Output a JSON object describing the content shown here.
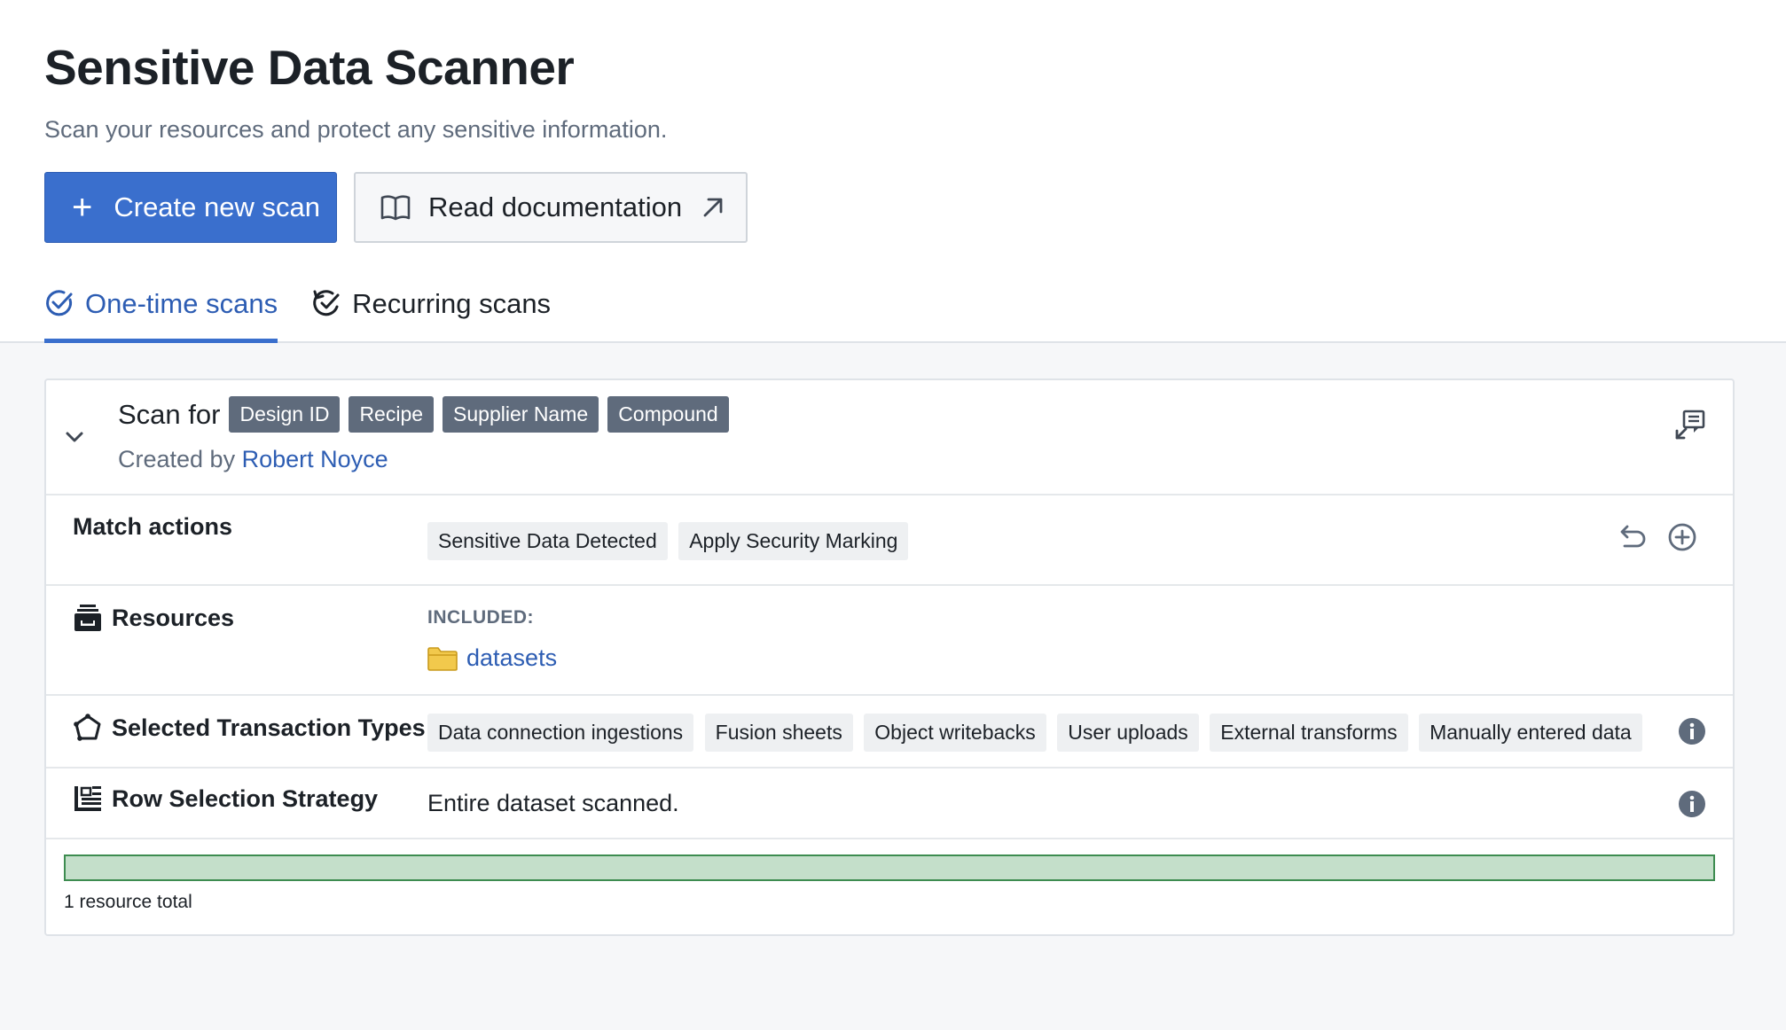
{
  "header": {
    "title": "Sensitive Data Scanner",
    "subtitle": "Scan your resources and protect any sensitive information.",
    "create_button": "Create new scan",
    "docs_button": "Read documentation"
  },
  "tabs": [
    {
      "label": "One-time scans",
      "active": true,
      "icon": "circle-check-icon"
    },
    {
      "label": "Recurring scans",
      "active": false,
      "icon": "recurring-check-icon"
    }
  ],
  "scan": {
    "scan_for_label": "Scan for",
    "categories": [
      "Design ID",
      "Recipe",
      "Supplier Name",
      "Compound"
    ],
    "created_by_label": "Created by",
    "created_by_name": "Robert Noyce",
    "rows": {
      "match_actions": {
        "label": "Match actions",
        "chips": [
          "Sensitive Data Detected",
          "Apply Security Marking"
        ]
      },
      "resources": {
        "label": "Resources",
        "included_label": "INCLUDED:",
        "folder": "datasets"
      },
      "transaction_types": {
        "label": "Selected Transaction Types",
        "chips": [
          "Data connection ingestions",
          "Fusion sheets",
          "Object writebacks",
          "User uploads",
          "External transforms",
          "Manually entered data"
        ]
      },
      "row_selection": {
        "label": "Row Selection Strategy",
        "value": "Entire dataset scanned."
      }
    },
    "progress": {
      "fraction": 1.0,
      "color": "#c4dfca",
      "border": "#3d8c50"
    },
    "total_text": "1 resource total"
  },
  "colors": {
    "primary": "#3a6fcd",
    "link": "#2d5db3",
    "chip_dark": "#5f6b7c",
    "folder": "#f2c94c"
  }
}
